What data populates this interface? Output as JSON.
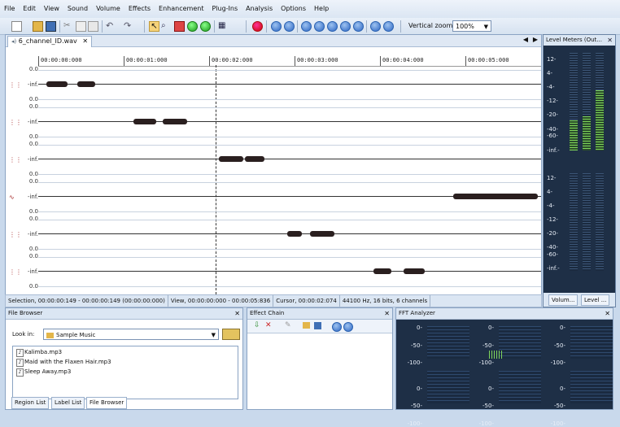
{
  "menu": [
    "File",
    "Edit",
    "View",
    "Sound",
    "Volume",
    "Effects",
    "Enhancement",
    "Plug-Ins",
    "Analysis",
    "Options",
    "Help"
  ],
  "toolbar": {
    "vertical_zoom_label": "Vertical zoom:",
    "vertical_zoom_value": "100%"
  },
  "editor": {
    "tab_title": "6_channel_ID.wav",
    "tab_icon": "wav-icon",
    "ruler": [
      "00:00:00:000",
      "00:00:01:000",
      "00:00:02:000",
      "00:00:03:000",
      "00:00:04:000",
      "00:00:05:000"
    ],
    "channel_top_label": "0.0",
    "channel_mid_label": "-inf.",
    "channel_bottom_label": "0.0"
  },
  "status": {
    "selection": "Selection, 00:00:00:149 - 00:00:00:149 (00:00:00:000)",
    "view": "View, 00:00:00:000 - 00:00:05:836",
    "cursor": "Cursor, 00:00:02:074",
    "format": "44100 Hz, 16 bits, 6 channels"
  },
  "level_meters": {
    "title": "Level Meters (Out...",
    "scale": [
      "12-",
      "4-",
      "-4-",
      "-12-",
      "-20-",
      "-40-",
      "-60-",
      "-inf.-"
    ],
    "tabs": [
      "Volum...",
      "Level ..."
    ]
  },
  "file_browser": {
    "title": "File Browser",
    "look_in_label": "Look in:",
    "folder": "Sample Music",
    "files": [
      "Kalimba.mp3",
      "Maid with the Flaxen Hair.mp3",
      "Sleep Away.mp3"
    ]
  },
  "effect_chain": {
    "title": "Effect Chain"
  },
  "fft": {
    "title": "FFT Analyzer",
    "scale": [
      "0-",
      "-50-",
      "-100-"
    ]
  },
  "bottom_tabs": [
    "Region List",
    "Label List",
    "File Browser"
  ]
}
